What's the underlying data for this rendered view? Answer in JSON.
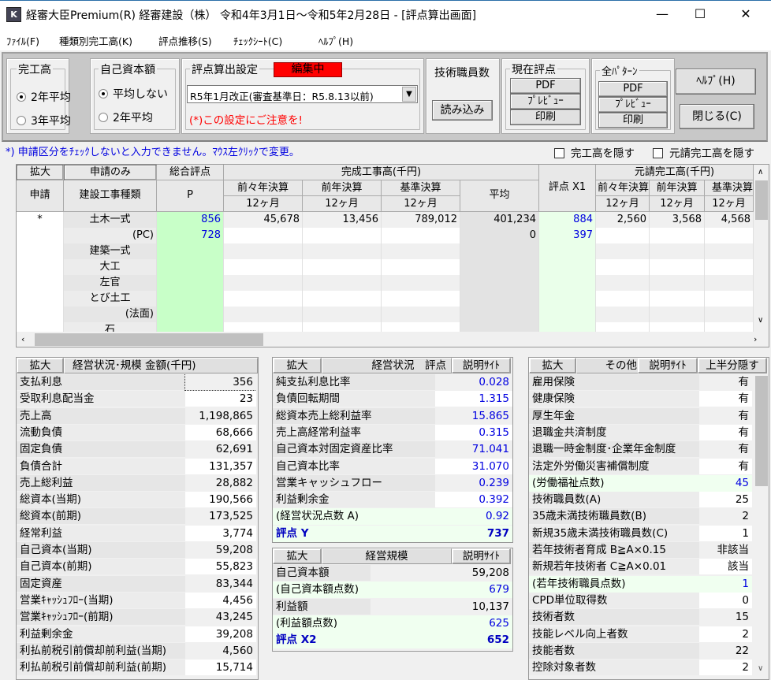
{
  "window": {
    "title": "経審大臣Premium(R)  経審建設（株）     令和4年3月1日～令和5年2月28日 - [評点算出画面]",
    "app_icon": "K",
    "minimize": "—",
    "maximize": "☐",
    "close": "✕"
  },
  "menu": [
    "ﾌｧｲﾙ(F)",
    "種類別完工高(K)",
    "評点推移(S)",
    "ﾁｪｯｸｼｰﾄ(C)",
    "ﾍﾙﾌﾟ(H)"
  ],
  "toolbar": {
    "completion": {
      "label": "完工高",
      "options": [
        "2年平均",
        "3年平均"
      ],
      "selected": 0
    },
    "equity": {
      "label": "自己資本額",
      "options": [
        "平均しない",
        "2年平均"
      ],
      "selected": 0
    },
    "setting": {
      "label": "評点算出設定",
      "badge": "編集中",
      "select_value": "R5年1月改正(審査基準日：R5.8.13以前)",
      "warning": "(*)この設定にご注意を!",
      "badge_color": "#ff0000"
    },
    "tech": {
      "label": "技術職員数",
      "button": "読み込み"
    },
    "current": {
      "label": "現在評点",
      "pdf": "PDF",
      "preview": "ﾌﾟﾚﾋﾞｭｰ",
      "print": "印刷"
    },
    "all": {
      "label": "全ﾊﾟﾀｰﾝ",
      "pdf": "PDF",
      "preview": "ﾌﾟﾚﾋﾞｭｰ",
      "print": "印刷"
    },
    "help": "ﾍﾙﾌﾟ(H)",
    "close": "閉じる(C)"
  },
  "note": "*) 申請区分をﾁｪｯｸしないと入力できません。ﾏｳｽ左ｸﾘｯｸで変更。",
  "checks": [
    {
      "label": "完工高を隠す",
      "checked": false
    },
    {
      "label": "元請完工高を隠す",
      "checked": false
    }
  ],
  "grid": {
    "headers": {
      "expand": "拡大",
      "apply_only": "申請のみ",
      "total": "総合評点",
      "completed": "完成工事高(千円)",
      "x1": "評点 X1",
      "prime": "元請完工高(千円)",
      "apply": "申請",
      "type": "建設工事種類",
      "p": "P",
      "y2": "前々年決算",
      "y1": "前年決算",
      "base": "基準決算",
      "avg": "平均",
      "m2": "前々年決算",
      "m1": "前年決算",
      "mb": "基準決算",
      "months": "12ヶ月"
    },
    "rows": [
      {
        "apply": "*",
        "type": "土木一式",
        "p": "856",
        "y2": "45,678",
        "y1": "13,456",
        "base": "789,012",
        "avg": "401,234",
        "x1": "884",
        "m2": "2,560",
        "m1": "3,568",
        "mb": "4,568"
      },
      {
        "apply": "",
        "type": "(PC)",
        "p": "728",
        "y2": "",
        "y1": "",
        "base": "",
        "avg": "0",
        "x1": "397",
        "m2": "",
        "m1": "",
        "mb": ""
      },
      {
        "apply": "",
        "type": "建築一式"
      },
      {
        "apply": "",
        "type": "大工"
      },
      {
        "apply": "",
        "type": "左官"
      },
      {
        "apply": "",
        "type": "とび土工"
      },
      {
        "apply": "",
        "type": "(法面)"
      },
      {
        "apply": "",
        "type": "石"
      }
    ]
  },
  "finance": {
    "expand": "拡大",
    "title": "経営状況･規模 金額(千円)",
    "rows": [
      {
        "label": "支払利息",
        "value": "356"
      },
      {
        "label": "受取利息配当金",
        "value": "23"
      },
      {
        "label": "売上高",
        "value": "1,198,865"
      },
      {
        "label": "流動負債",
        "value": "68,666"
      },
      {
        "label": "固定負債",
        "value": "62,691"
      },
      {
        "label": "負債合計",
        "value": "131,357"
      },
      {
        "label": "売上総利益",
        "value": "28,882"
      },
      {
        "label": "総資本(当期)",
        "value": "190,566"
      },
      {
        "label": "総資本(前期)",
        "value": "173,525"
      },
      {
        "label": "経常利益",
        "value": "3,774"
      },
      {
        "label": "自己資本(当期)",
        "value": "59,208"
      },
      {
        "label": "自己資本(前期)",
        "value": "55,823"
      },
      {
        "label": "固定資産",
        "value": "83,344"
      },
      {
        "label": "営業ｷｬｯｼｭﾌﾛｰ(当期)",
        "value": "4,456"
      },
      {
        "label": "営業ｷｬｯｼｭﾌﾛｰ(前期)",
        "value": "43,245"
      },
      {
        "label": "利益剰余金",
        "value": "39,208"
      },
      {
        "label": "利払前税引前償却前利益(当期)",
        "value": "4,560"
      },
      {
        "label": "利払前税引前償却前利益(前期)",
        "value": "15,714"
      }
    ]
  },
  "status": {
    "expand": "拡大",
    "title": "経営状況　評点",
    "site": "説明ｻｲﾄ",
    "rows": [
      {
        "label": "純支払利息比率",
        "value": "0.028"
      },
      {
        "label": "負債回転期間",
        "value": "1.315"
      },
      {
        "label": "総資本売上総利益率",
        "value": "15.865"
      },
      {
        "label": "売上高経常利益率",
        "value": "0.315"
      },
      {
        "label": "自己資本対固定資産比率",
        "value": "71.041"
      },
      {
        "label": "自己資本比率",
        "value": "31.070"
      },
      {
        "label": "営業キャッシュフロー",
        "value": "0.239"
      },
      {
        "label": "利益剰余金",
        "value": "0.392"
      },
      {
        "label": "(経営状況点数 A)",
        "value": "0.92",
        "kind": "sub"
      },
      {
        "label": "評点 Y",
        "value": "737",
        "kind": "total"
      }
    ]
  },
  "scale": {
    "expand": "拡大",
    "title": "経営規模",
    "site": "説明ｻｲﾄ",
    "rows": [
      {
        "label": "自己資本額",
        "value": "59,208"
      },
      {
        "label": "(自己資本額点数)",
        "value": "679",
        "kind": "sub"
      },
      {
        "label": "利益額",
        "value": "10,137"
      },
      {
        "label": "(利益額点数)",
        "value": "625",
        "kind": "sub"
      },
      {
        "label": "評点 X2",
        "value": "652",
        "kind": "total"
      }
    ]
  },
  "other": {
    "expand": "拡大",
    "title": "その他",
    "site": "説明ｻｲﾄ",
    "hide_top": "上半分隠す",
    "rows": [
      {
        "label": "雇用保険",
        "value": "有"
      },
      {
        "label": "健康保険",
        "value": "有"
      },
      {
        "label": "厚生年金",
        "value": "有"
      },
      {
        "label": "退職金共済制度",
        "value": "有"
      },
      {
        "label": "退職一時金制度･企業年金制度",
        "value": "有"
      },
      {
        "label": "法定外労働災害補償制度",
        "value": "有"
      },
      {
        "label": "(労働福祉点数)",
        "value": "45",
        "kind": "sub"
      },
      {
        "label": "技術職員数(A)",
        "value": "25"
      },
      {
        "label": "35歳未満技術職員数(B)",
        "value": "2"
      },
      {
        "label": "新規35歳未満技術職員数(C)",
        "value": "1"
      },
      {
        "label": "若年技術者育成  B≧A×0.15",
        "value": "非該当"
      },
      {
        "label": "新規若年技術者  C≧A×0.01",
        "value": "該当"
      },
      {
        "label": "(若年技術職員点数)",
        "value": "1",
        "kind": "sub"
      },
      {
        "label": "CPD単位取得数",
        "value": "0"
      },
      {
        "label": "技術者数",
        "value": "15"
      },
      {
        "label": "技能レベル向上者数",
        "value": "2"
      },
      {
        "label": "技能者数",
        "value": "22"
      },
      {
        "label": "控除対象者数",
        "value": "2"
      }
    ]
  }
}
